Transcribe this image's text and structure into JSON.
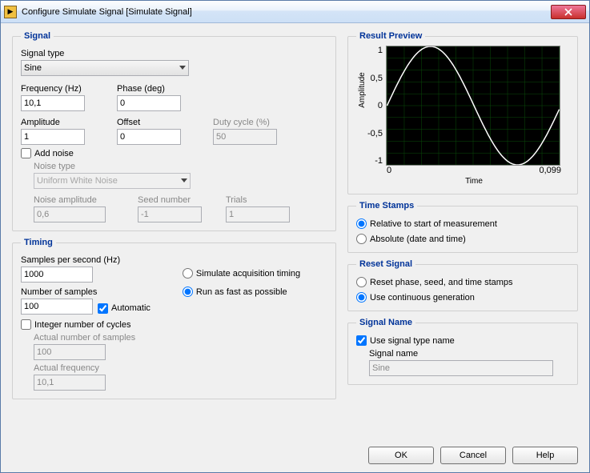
{
  "window": {
    "title": "Configure Simulate Signal [Simulate Signal]"
  },
  "signal": {
    "legend": "Signal",
    "type_label": "Signal type",
    "type_value": "Sine",
    "freq_label": "Frequency (Hz)",
    "freq_value": "10,1",
    "phase_label": "Phase (deg)",
    "phase_value": "0",
    "amp_label": "Amplitude",
    "amp_value": "1",
    "offset_label": "Offset",
    "offset_value": "0",
    "duty_label": "Duty cycle (%)",
    "duty_value": "50",
    "addnoise_label": "Add noise",
    "noisetype_label": "Noise type",
    "noisetype_value": "Uniform White Noise",
    "noiseamp_label": "Noise amplitude",
    "noiseamp_value": "0,6",
    "seed_label": "Seed number",
    "seed_value": "-1",
    "trials_label": "Trials",
    "trials_value": "1"
  },
  "timing": {
    "legend": "Timing",
    "sps_label": "Samples per second (Hz)",
    "sps_value": "1000",
    "nos_label": "Number of samples",
    "nos_value": "100",
    "auto_label": "Automatic",
    "sim_label": "Simulate acquisition timing",
    "fast_label": "Run as fast as possible",
    "intcyc_label": "Integer number of cycles",
    "actnum_label": "Actual number of samples",
    "actnum_value": "100",
    "actfreq_label": "Actual frequency",
    "actfreq_value": "10,1"
  },
  "preview": {
    "legend": "Result Preview",
    "ylabel": "Amplitude",
    "xlabel": "Time",
    "yt1": "1",
    "yt2": "0,5",
    "yt3": "0",
    "yt4": "-0,5",
    "yt5": "-1",
    "xt0": "0",
    "xt1": "0,099"
  },
  "timestamps": {
    "legend": "Time Stamps",
    "rel_label": "Relative to start of measurement",
    "abs_label": "Absolute (date and time)"
  },
  "reset": {
    "legend": "Reset Signal",
    "phase_label": "Reset phase, seed, and time stamps",
    "cont_label": "Use continuous generation"
  },
  "signame": {
    "legend": "Signal Name",
    "use_label": "Use signal type name",
    "name_label": "Signal name",
    "name_value": "Sine"
  },
  "buttons": {
    "ok": "OK",
    "cancel": "Cancel",
    "help": "Help"
  },
  "chart_data": {
    "type": "line",
    "title": "",
    "xlabel": "Time",
    "ylabel": "Amplitude",
    "xlim": [
      0,
      0.099
    ],
    "ylim": [
      -1,
      1
    ],
    "function": "sin(2*pi*10.1*t)",
    "n_points": 100,
    "x": [
      0,
      0.001,
      0.002,
      0.003,
      0.004,
      0.005,
      0.006,
      0.007,
      0.008,
      0.009,
      0.01,
      0.011,
      0.012,
      0.013,
      0.014,
      0.015,
      0.016,
      0.017,
      0.018,
      0.019,
      0.02,
      0.021,
      0.022,
      0.023,
      0.024,
      0.025,
      0.026,
      0.027,
      0.028,
      0.029,
      0.03,
      0.031,
      0.032,
      0.033,
      0.034,
      0.035,
      0.036,
      0.037,
      0.038,
      0.039,
      0.04,
      0.041,
      0.042,
      0.043,
      0.044,
      0.045,
      0.046,
      0.047,
      0.048,
      0.049,
      0.05,
      0.051,
      0.052,
      0.053,
      0.054,
      0.055,
      0.056,
      0.057,
      0.058,
      0.059,
      0.06,
      0.061,
      0.062,
      0.063,
      0.064,
      0.065,
      0.066,
      0.067,
      0.068,
      0.069,
      0.07,
      0.071,
      0.072,
      0.073,
      0.074,
      0.075,
      0.076,
      0.077,
      0.078,
      0.079,
      0.08,
      0.081,
      0.082,
      0.083,
      0.084,
      0.085,
      0.086,
      0.087,
      0.088,
      0.089,
      0.09,
      0.091,
      0.092,
      0.093,
      0.094,
      0.095,
      0.096,
      0.097,
      0.098,
      0.099
    ],
    "y": [
      0,
      0.063,
      0.125,
      0.187,
      0.249,
      0.309,
      0.368,
      0.426,
      0.482,
      0.536,
      0.588,
      0.637,
      0.685,
      0.729,
      0.77,
      0.809,
      0.844,
      0.876,
      0.905,
      0.93,
      0.951,
      0.969,
      0.982,
      0.992,
      0.998,
      1,
      0.998,
      0.992,
      0.982,
      0.969,
      0.951,
      0.93,
      0.905,
      0.876,
      0.844,
      0.809,
      0.77,
      0.729,
      0.685,
      0.637,
      0.588,
      0.536,
      0.482,
      0.426,
      0.368,
      0.309,
      0.249,
      0.187,
      0.125,
      0.063,
      0,
      -0.063,
      -0.125,
      -0.187,
      -0.249,
      -0.309,
      -0.368,
      -0.426,
      -0.482,
      -0.536,
      -0.588,
      -0.637,
      -0.685,
      -0.729,
      -0.77,
      -0.809,
      -0.844,
      -0.876,
      -0.905,
      -0.93,
      -0.951,
      -0.969,
      -0.982,
      -0.992,
      -0.998,
      -1,
      -0.998,
      -0.992,
      -0.982,
      -0.969,
      -0.951,
      -0.93,
      -0.905,
      -0.876,
      -0.844,
      -0.809,
      -0.77,
      -0.729,
      -0.685,
      -0.637,
      -0.588,
      -0.536,
      -0.482,
      -0.426,
      -0.368,
      -0.309,
      -0.249,
      -0.187,
      -0.125,
      -0.063
    ]
  }
}
